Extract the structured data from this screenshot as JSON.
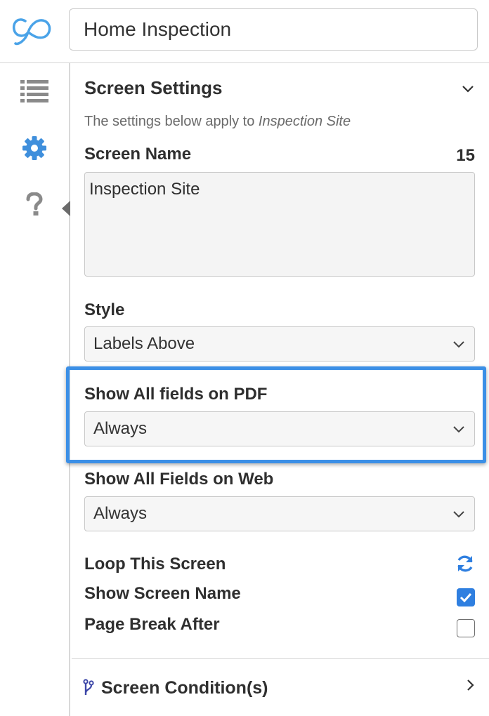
{
  "header": {
    "logo_icon": "gocanvas-logo-icon",
    "form_title": "Home Inspection"
  },
  "sidebar": {
    "items": [
      {
        "icon": "list-icon",
        "active": false
      },
      {
        "icon": "gear-icon",
        "active": true
      },
      {
        "icon": "question-icon",
        "active": false
      }
    ]
  },
  "panel": {
    "heading": "Screen Settings",
    "subtext_prefix": "The settings below apply to ",
    "subtext_target": "Inspection Site",
    "screen_name": {
      "label": "Screen Name",
      "remaining_count": "15",
      "value": "Inspection Site"
    },
    "style": {
      "label": "Style",
      "selected": "Labels Above"
    },
    "show_all_pdf": {
      "label": "Show All fields on PDF",
      "selected": "Always",
      "highlighted": true
    },
    "show_all_web": {
      "label": "Show All Fields on Web",
      "selected": "Always"
    },
    "loop_screen": {
      "label": "Loop This Screen",
      "icon": "loop-refresh-icon"
    },
    "show_screen_name": {
      "label": "Show Screen Name",
      "checked": true
    },
    "page_break_after": {
      "label": "Page Break After",
      "checked": false
    },
    "conditions": {
      "label": "Screen Condition(s)",
      "icon": "branch-icon"
    }
  },
  "colors": {
    "accent_blue": "#2f7fe0",
    "highlight_border": "#3b8fe6",
    "icon_gray": "#8a8a8a"
  }
}
